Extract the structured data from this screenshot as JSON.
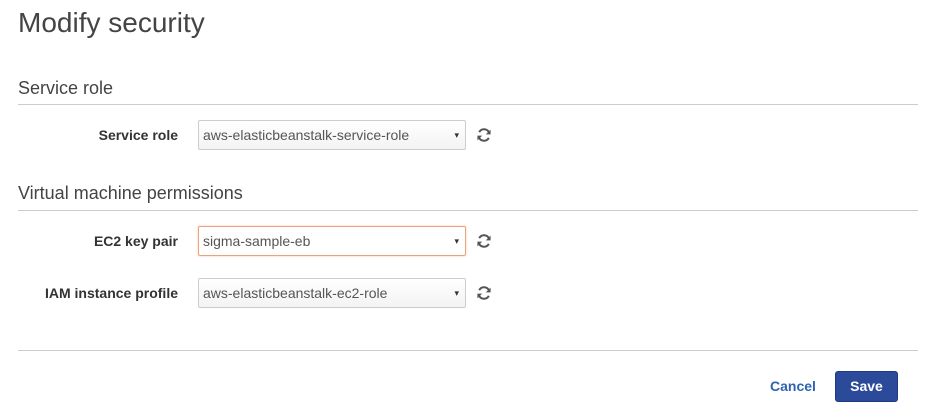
{
  "page_title": "Modify security",
  "sections": [
    {
      "header": "Service role",
      "fields": [
        {
          "label": "Service role",
          "value": "aws-elasticbeanstalk-service-role",
          "icon": "refresh-icon"
        }
      ]
    },
    {
      "header": "Virtual machine permissions",
      "fields": [
        {
          "label": "EC2 key pair",
          "value": "sigma-sample-eb",
          "icon": "refresh-icon",
          "focused": true
        },
        {
          "label": "IAM instance profile",
          "value": "aws-elasticbeanstalk-ec2-role",
          "icon": "refresh-icon"
        }
      ]
    }
  ],
  "select_caret": "▾",
  "actions": {
    "cancel_label": "Cancel",
    "save_label": "Save"
  },
  "colors": {
    "save_button": "#2b4a9a",
    "link": "#2f63b3",
    "focus_border": "#e8a47c"
  }
}
